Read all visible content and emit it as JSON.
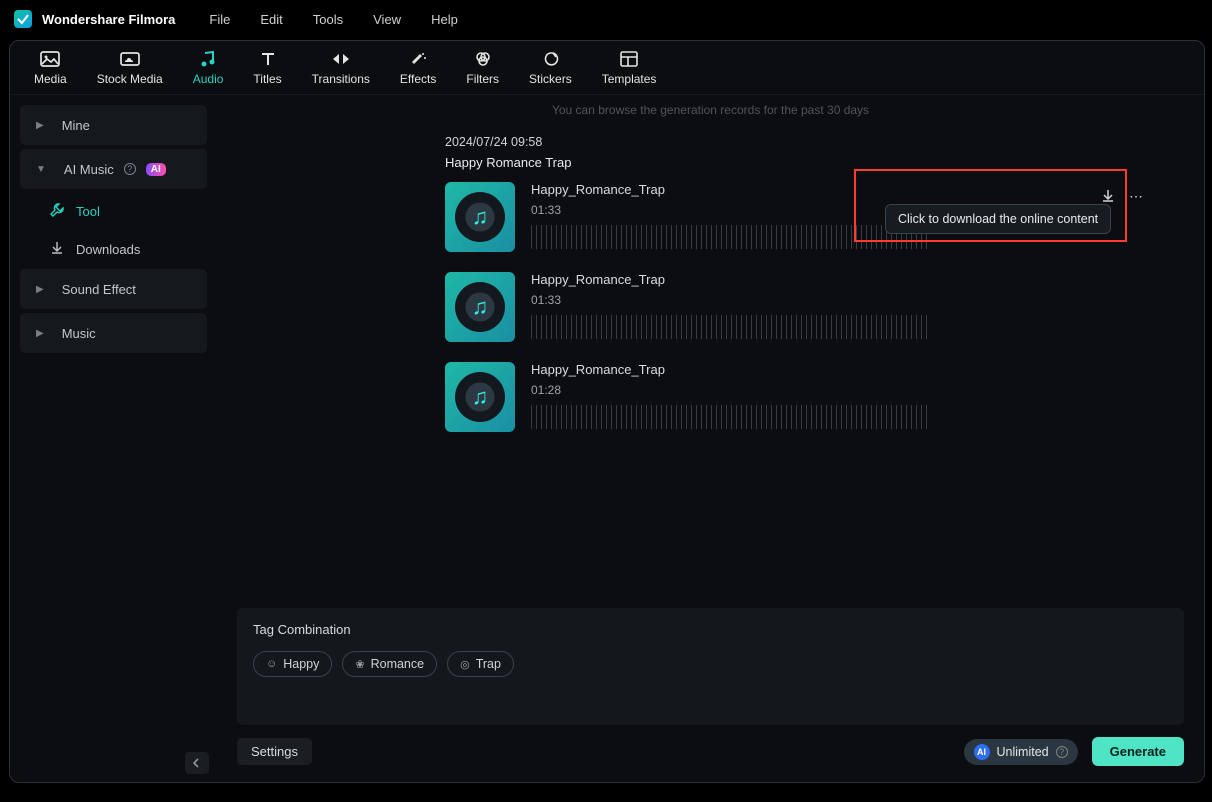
{
  "app_name": "Wondershare Filmora",
  "menu": {
    "file": "File",
    "edit": "Edit",
    "tools": "Tools",
    "view": "View",
    "help": "Help"
  },
  "tabs": {
    "media": "Media",
    "stock": "Stock Media",
    "audio": "Audio",
    "titles": "Titles",
    "transitions": "Transitions",
    "effects": "Effects",
    "filters": "Filters",
    "stickers": "Stickers",
    "templates": "Templates"
  },
  "sidebar": {
    "mine": "Mine",
    "ai_music": "AI Music",
    "ai_badge": "AI",
    "tool": "Tool",
    "downloads": "Downloads",
    "sound_effect": "Sound Effect",
    "music": "Music"
  },
  "hint": "You can browse the generation records for the past 30 days",
  "group": {
    "date": "2024/07/24 09:58",
    "title": "Happy Romance Trap"
  },
  "tracks": [
    {
      "name": "Happy_Romance_Trap",
      "dur": "01:33"
    },
    {
      "name": "Happy_Romance_Trap",
      "dur": "01:33"
    },
    {
      "name": "Happy_Romance_Trap",
      "dur": "01:28"
    }
  ],
  "tooltip": "Click to download the online content",
  "tag_section": {
    "title": "Tag Combination",
    "tags": [
      "Happy",
      "Romance",
      "Trap"
    ]
  },
  "bottom": {
    "settings": "Settings",
    "unlimited": "Unlimited",
    "generate": "Generate"
  }
}
